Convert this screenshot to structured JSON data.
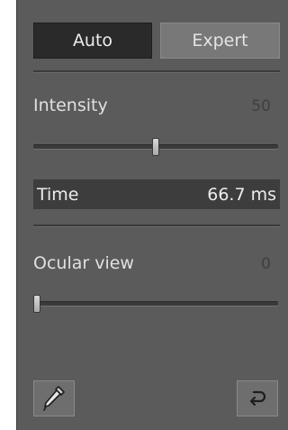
{
  "mode": {
    "auto_label": "Auto",
    "expert_label": "Expert",
    "selected": "Auto"
  },
  "intensity": {
    "label": "Intensity",
    "value": "50",
    "slider_fraction": 0.5
  },
  "time": {
    "label": "Time",
    "value": "66.7 ms"
  },
  "ocular": {
    "label": "Ocular view",
    "value": "0",
    "slider_fraction": 0.0
  },
  "toolbar": {
    "picker_icon": "eyedropper-icon",
    "reset_icon": "undo-icon"
  }
}
